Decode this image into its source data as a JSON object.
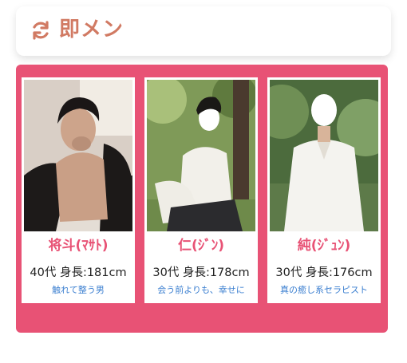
{
  "header": {
    "icon": "refresh-icon",
    "title": "即メン"
  },
  "colors": {
    "accent": "#e85275",
    "title": "#d17a63",
    "catch_text": "#3b7fd0"
  },
  "therapists": [
    {
      "name": "将斗(ﾏｻﾄ)",
      "stats": "40代 身長:181cm",
      "catch": "触れて整う男",
      "photo": "therapist-photo"
    },
    {
      "name": "仁(ｼﾞﾝ)",
      "stats": "30代 身長:178cm",
      "catch": "会う前よりも、幸せに",
      "photo": "therapist-photo"
    },
    {
      "name": "純(ｼﾞｭﾝ)",
      "stats": "30代 身長:176cm",
      "catch": "真の癒し系セラピスト",
      "photo": "therapist-photo"
    }
  ]
}
